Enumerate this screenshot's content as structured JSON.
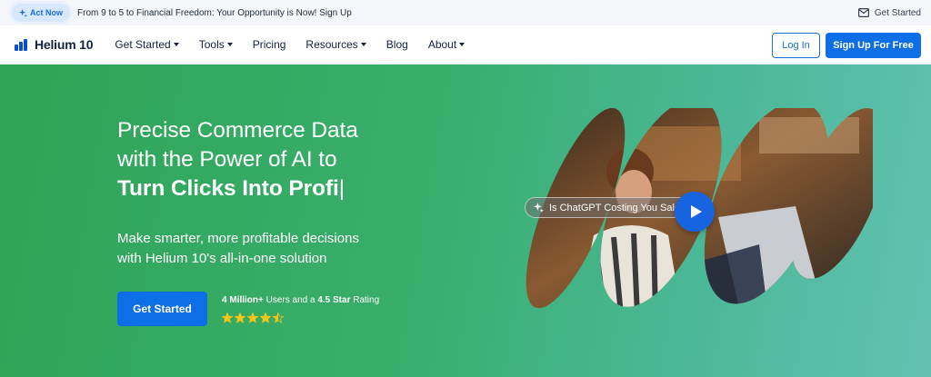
{
  "announcement": {
    "pill_label": "Act Now",
    "pill_icon": "sparkle-icon",
    "text": "From 9 to 5 to Financial Freedom: Your Opportunity is Now! Sign Up",
    "right_link": "Get Started",
    "right_icon": "mail-icon"
  },
  "nav": {
    "brand": "Helium 10",
    "items": [
      {
        "label": "Get Started",
        "dropdown": true
      },
      {
        "label": "Tools",
        "dropdown": true
      },
      {
        "label": "Pricing",
        "dropdown": false
      },
      {
        "label": "Resources",
        "dropdown": true
      },
      {
        "label": "Blog",
        "dropdown": false
      },
      {
        "label": "About",
        "dropdown": true
      }
    ],
    "login": "Log In",
    "signup": "Sign Up For Free"
  },
  "hero": {
    "headline_line1": "Precise Commerce Data",
    "headline_line2": "with the Power of AI to",
    "headline_line3": "Turn Clicks Into Profi",
    "cursor": "|",
    "sub_line1": "Make smarter, more profitable decisions",
    "sub_line2": "with Helium 10's all-in-one solution",
    "cta": "Get Started",
    "rating_users": "4 Million+",
    "rating_mid": " Users and a ",
    "rating_stars_text": "4.5 Star",
    "rating_end": " Rating",
    "stars_value": 4.5,
    "stars_max": 5,
    "video_pill": "Is ChatGPT Costing You Sales?",
    "video_pill_icon": "sparkle-icon",
    "play_icon": "play-icon"
  },
  "colors": {
    "brand_blue": "#0d6ee6",
    "hero_green": "#34a85f",
    "hero_teal": "#63c1b2",
    "star_gold": "#f5c518"
  }
}
